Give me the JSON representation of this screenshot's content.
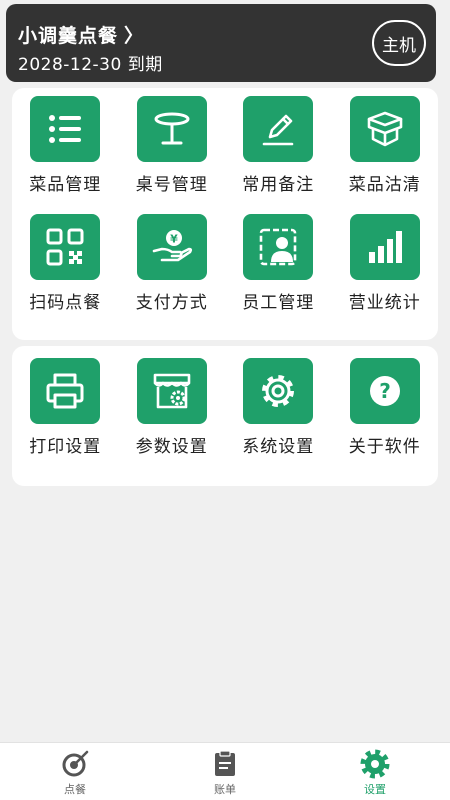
{
  "header": {
    "shop_name": "小调羹点餐",
    "chevron": "〉",
    "expiry": "2028-12-30 到期",
    "role_button": "主机"
  },
  "colors": {
    "accent": "#1fa06a",
    "header_bg": "#333333",
    "page_bg": "#f0f0f0"
  },
  "management": {
    "items": [
      {
        "label": "菜品管理",
        "icon": "list-icon"
      },
      {
        "label": "桌号管理",
        "icon": "table-icon"
      },
      {
        "label": "常用备注",
        "icon": "pencil-icon"
      },
      {
        "label": "菜品沽清",
        "icon": "box-icon"
      },
      {
        "label": "扫码点餐",
        "icon": "qrcode-icon"
      },
      {
        "label": "支付方式",
        "icon": "payment-hand-icon"
      },
      {
        "label": "员工管理",
        "icon": "employee-icon"
      },
      {
        "label": "营业统计",
        "icon": "bar-chart-icon"
      }
    ]
  },
  "settings": {
    "items": [
      {
        "label": "打印设置",
        "icon": "printer-icon"
      },
      {
        "label": "参数设置",
        "icon": "shop-gear-icon"
      },
      {
        "label": "系统设置",
        "icon": "gear-icon"
      },
      {
        "label": "关于软件",
        "icon": "help-icon"
      }
    ]
  },
  "nav": {
    "items": [
      {
        "label": "点餐",
        "icon": "order-icon",
        "active": false
      },
      {
        "label": "账单",
        "icon": "bill-icon",
        "active": false
      },
      {
        "label": "设置",
        "icon": "settings-icon",
        "active": true
      }
    ]
  }
}
